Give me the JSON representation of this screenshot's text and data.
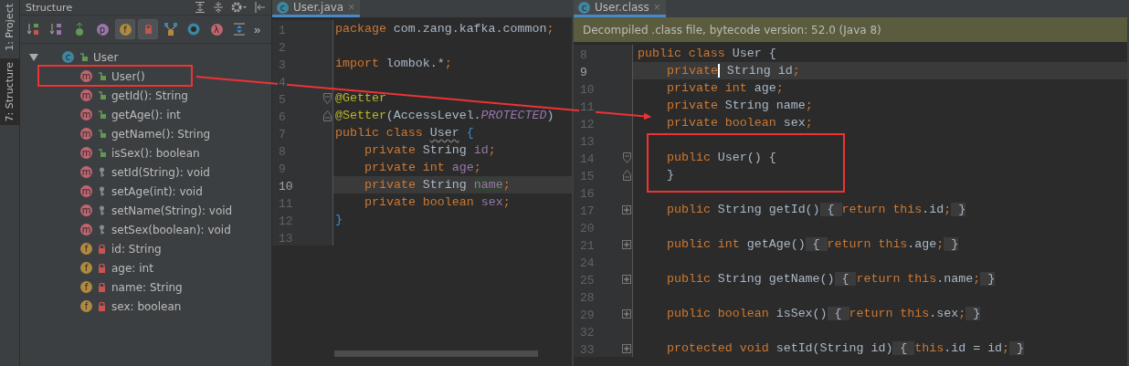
{
  "side_tabs": [
    {
      "label": "1: Project",
      "selected": false
    },
    {
      "label": "7: Structure",
      "selected": true
    }
  ],
  "structure": {
    "title": "Structure",
    "toolbar": [
      {
        "kind": "sort-visibility",
        "selected": false
      },
      {
        "kind": "sort-alpha",
        "selected": false
      },
      {
        "kind": "inherited",
        "selected": false
      },
      {
        "kind": "badge",
        "badge": "p",
        "color": "#9876aa",
        "selected": false
      },
      {
        "kind": "badge",
        "badge": "f",
        "color": "#b08a3e",
        "selected": true
      },
      {
        "kind": "lock",
        "selected": true
      },
      {
        "kind": "hierarchy",
        "selected": false
      },
      {
        "kind": "ring",
        "selected": false
      },
      {
        "kind": "badge",
        "badge": "λ",
        "color": "#c06470",
        "selected": false
      },
      {
        "kind": "expand",
        "selected": false
      }
    ],
    "more": "»",
    "tree": {
      "badge": "c",
      "kind": "public",
      "label": "User",
      "expanded": true,
      "children": [
        {
          "badge": "m",
          "kind": "public",
          "label": "User()"
        },
        {
          "badge": "m",
          "kind": "public",
          "label": "getId(): String"
        },
        {
          "badge": "m",
          "kind": "public",
          "label": "getAge(): int"
        },
        {
          "badge": "m",
          "kind": "public",
          "label": "getName(): String"
        },
        {
          "badge": "m",
          "kind": "public",
          "label": "isSex(): boolean"
        },
        {
          "badge": "m",
          "kind": "protected",
          "label": "setId(String): void"
        },
        {
          "badge": "m",
          "kind": "protected",
          "label": "setAge(int): void"
        },
        {
          "badge": "m",
          "kind": "protected",
          "label": "setName(String): void"
        },
        {
          "badge": "m",
          "kind": "protected",
          "label": "setSex(boolean): void"
        },
        {
          "badge": "f",
          "kind": "private",
          "label": "id: String"
        },
        {
          "badge": "f",
          "kind": "private",
          "label": "age: int"
        },
        {
          "badge": "f",
          "kind": "private",
          "label": "name: String"
        },
        {
          "badge": "f",
          "kind": "private",
          "label": "sex: boolean"
        }
      ]
    }
  },
  "editors": [
    {
      "tab": {
        "badge": "c",
        "label": "User.java",
        "close": "×"
      },
      "lines": [
        {
          "number": "1",
          "kind": "text",
          "tokens": [
            {
              "kind": "keyword",
              "text": "package "
            },
            {
              "kind": "plain",
              "text": "com.zang.kafka.common"
            },
            {
              "kind": "keyword",
              "text": ";"
            }
          ]
        },
        {
          "number": "2",
          "kind": "text"
        },
        {
          "number": "3",
          "kind": "text",
          "tokens": [
            {
              "kind": "keyword",
              "text": "import "
            },
            {
              "kind": "plain",
              "text": "lombok.*"
            },
            {
              "kind": "keyword",
              "text": ";"
            }
          ]
        },
        {
          "number": "4",
          "kind": "text"
        },
        {
          "number": "5",
          "kind": "foldstart",
          "tokens": [
            {
              "kind": "annotation",
              "text": "@Getter"
            }
          ]
        },
        {
          "number": "6",
          "kind": "foldend",
          "tokens": [
            {
              "kind": "annotation",
              "text": "@Setter"
            },
            {
              "kind": "plain",
              "text": "(AccessLevel."
            },
            {
              "kind": "constant",
              "text": "PROTECTED"
            },
            {
              "kind": "plain",
              "text": ")"
            }
          ]
        },
        {
          "number": "7",
          "kind": "text",
          "tokens": [
            {
              "kind": "keyword",
              "text": "public class "
            },
            {
              "kind": "unused",
              "text": "User"
            },
            {
              "kind": "brace",
              "text": " {"
            }
          ],
          "children": [
            {
              "number": "8",
              "kind": "text",
              "tokens": [
                {
                  "kind": "keyword",
                  "text": "private "
                },
                {
                  "kind": "plain",
                  "text": "String "
                },
                {
                  "kind": "field",
                  "text": "id"
                },
                {
                  "kind": "keyword",
                  "text": ";"
                }
              ]
            },
            {
              "number": "9",
              "kind": "text",
              "tokens": [
                {
                  "kind": "keyword",
                  "text": "private int "
                },
                {
                  "kind": "field",
                  "text": "age"
                },
                {
                  "kind": "keyword",
                  "text": ";"
                }
              ]
            },
            {
              "number": "10",
              "kind": "text",
              "current": true,
              "tokens": [
                {
                  "kind": "keyword",
                  "text": "private "
                },
                {
                  "kind": "plain",
                  "text": "String "
                },
                {
                  "kind": "usage",
                  "text": "name"
                },
                {
                  "kind": "keyword",
                  "text": ";"
                }
              ]
            },
            {
              "number": "11",
              "kind": "text",
              "tokens": [
                {
                  "kind": "keyword",
                  "text": "private boolean "
                },
                {
                  "kind": "field",
                  "text": "sex"
                },
                {
                  "kind": "keyword",
                  "text": ";"
                }
              ]
            }
          ]
        },
        {
          "number": "12",
          "kind": "text",
          "tokens": [
            {
              "kind": "brace",
              "text": "}"
            }
          ]
        },
        {
          "number": "13",
          "kind": "text"
        }
      ]
    },
    {
      "tab": {
        "badge": "c",
        "label": "User.class",
        "close": "×"
      },
      "banner": "Decompiled .class file, bytecode version: 52.0 (Java 8)",
      "lines": [
        {
          "number": "8",
          "kind": "text",
          "tokens": [
            {
              "kind": "keyword",
              "text": "public class "
            },
            {
              "kind": "plain",
              "text": "User {"
            }
          ],
          "children": [
            {
              "number": "9",
              "kind": "text",
              "current": true,
              "tokens": [
                {
                  "kind": "keyword",
                  "text": "private",
                  "caret": true
                },
                {
                  "kind": "plain",
                  "text": " String id"
                },
                {
                  "kind": "keyword",
                  "text": ";"
                }
              ]
            },
            {
              "number": "10",
              "kind": "text",
              "tokens": [
                {
                  "kind": "keyword",
                  "text": "private int "
                },
                {
                  "kind": "plain",
                  "text": "age"
                },
                {
                  "kind": "keyword",
                  "text": ";"
                }
              ]
            },
            {
              "number": "11",
              "kind": "text",
              "tokens": [
                {
                  "kind": "keyword",
                  "text": "private "
                },
                {
                  "kind": "plain",
                  "text": "String name"
                },
                {
                  "kind": "keyword",
                  "text": ";"
                }
              ]
            },
            {
              "number": "12",
              "kind": "text",
              "tokens": [
                {
                  "kind": "keyword",
                  "text": "private boolean "
                },
                {
                  "kind": "plain",
                  "text": "sex"
                },
                {
                  "kind": "keyword",
                  "text": ";"
                }
              ]
            },
            {
              "number": "13",
              "kind": "text"
            },
            {
              "number": "14",
              "kind": "foldstart",
              "tokens": [
                {
                  "kind": "keyword",
                  "text": "public "
                },
                {
                  "kind": "plain",
                  "text": "User() {"
                }
              ]
            },
            {
              "number": "15",
              "kind": "foldend",
              "tokens": [
                {
                  "kind": "plain",
                  "text": "}"
                }
              ]
            },
            {
              "number": "16",
              "kind": "text"
            },
            {
              "number": "17",
              "kind": "collapsed",
              "tokens": [
                {
                  "kind": "keyword",
                  "text": "public "
                },
                {
                  "kind": "plain",
                  "text": "String getId()"
                },
                {
                  "kind": "folded",
                  "text": " { "
                },
                {
                  "kind": "keyword",
                  "text": "return this"
                },
                {
                  "kind": "plain",
                  "text": ".id"
                },
                {
                  "kind": "keyword",
                  "text": ";"
                },
                {
                  "kind": "folded",
                  "text": " }"
                }
              ]
            },
            {
              "number": "20",
              "kind": "text"
            },
            {
              "number": "21",
              "kind": "collapsed",
              "tokens": [
                {
                  "kind": "keyword",
                  "text": "public int "
                },
                {
                  "kind": "plain",
                  "text": "getAge()"
                },
                {
                  "kind": "folded",
                  "text": " { "
                },
                {
                  "kind": "keyword",
                  "text": "return this"
                },
                {
                  "kind": "plain",
                  "text": ".age"
                },
                {
                  "kind": "keyword",
                  "text": ";"
                },
                {
                  "kind": "folded",
                  "text": " }"
                }
              ]
            },
            {
              "number": "24",
              "kind": "text"
            },
            {
              "number": "25",
              "kind": "collapsed",
              "tokens": [
                {
                  "kind": "keyword",
                  "text": "public "
                },
                {
                  "kind": "plain",
                  "text": "String getName()"
                },
                {
                  "kind": "folded",
                  "text": " { "
                },
                {
                  "kind": "keyword",
                  "text": "return this"
                },
                {
                  "kind": "plain",
                  "text": ".name"
                },
                {
                  "kind": "keyword",
                  "text": ";"
                },
                {
                  "kind": "folded",
                  "text": " }"
                }
              ]
            },
            {
              "number": "28",
              "kind": "text"
            },
            {
              "number": "29",
              "kind": "collapsed",
              "tokens": [
                {
                  "kind": "keyword",
                  "text": "public boolean "
                },
                {
                  "kind": "plain",
                  "text": "isSex()"
                },
                {
                  "kind": "folded",
                  "text": " { "
                },
                {
                  "kind": "keyword",
                  "text": "return this"
                },
                {
                  "kind": "plain",
                  "text": ".sex"
                },
                {
                  "kind": "keyword",
                  "text": ";"
                },
                {
                  "kind": "folded",
                  "text": " }"
                }
              ]
            },
            {
              "number": "32",
              "kind": "text"
            },
            {
              "number": "33",
              "kind": "collapsed",
              "tokens": [
                {
                  "kind": "keyword",
                  "text": "protected void "
                },
                {
                  "kind": "plain",
                  "text": "setId(String id)"
                },
                {
                  "kind": "folded",
                  "text": " { "
                },
                {
                  "kind": "keyword",
                  "text": "this"
                },
                {
                  "kind": "plain",
                  "text": ".id = id"
                },
                {
                  "kind": "keyword",
                  "text": ";"
                },
                {
                  "kind": "folded",
                  "text": " }"
                }
              ]
            }
          ]
        }
      ]
    }
  ]
}
